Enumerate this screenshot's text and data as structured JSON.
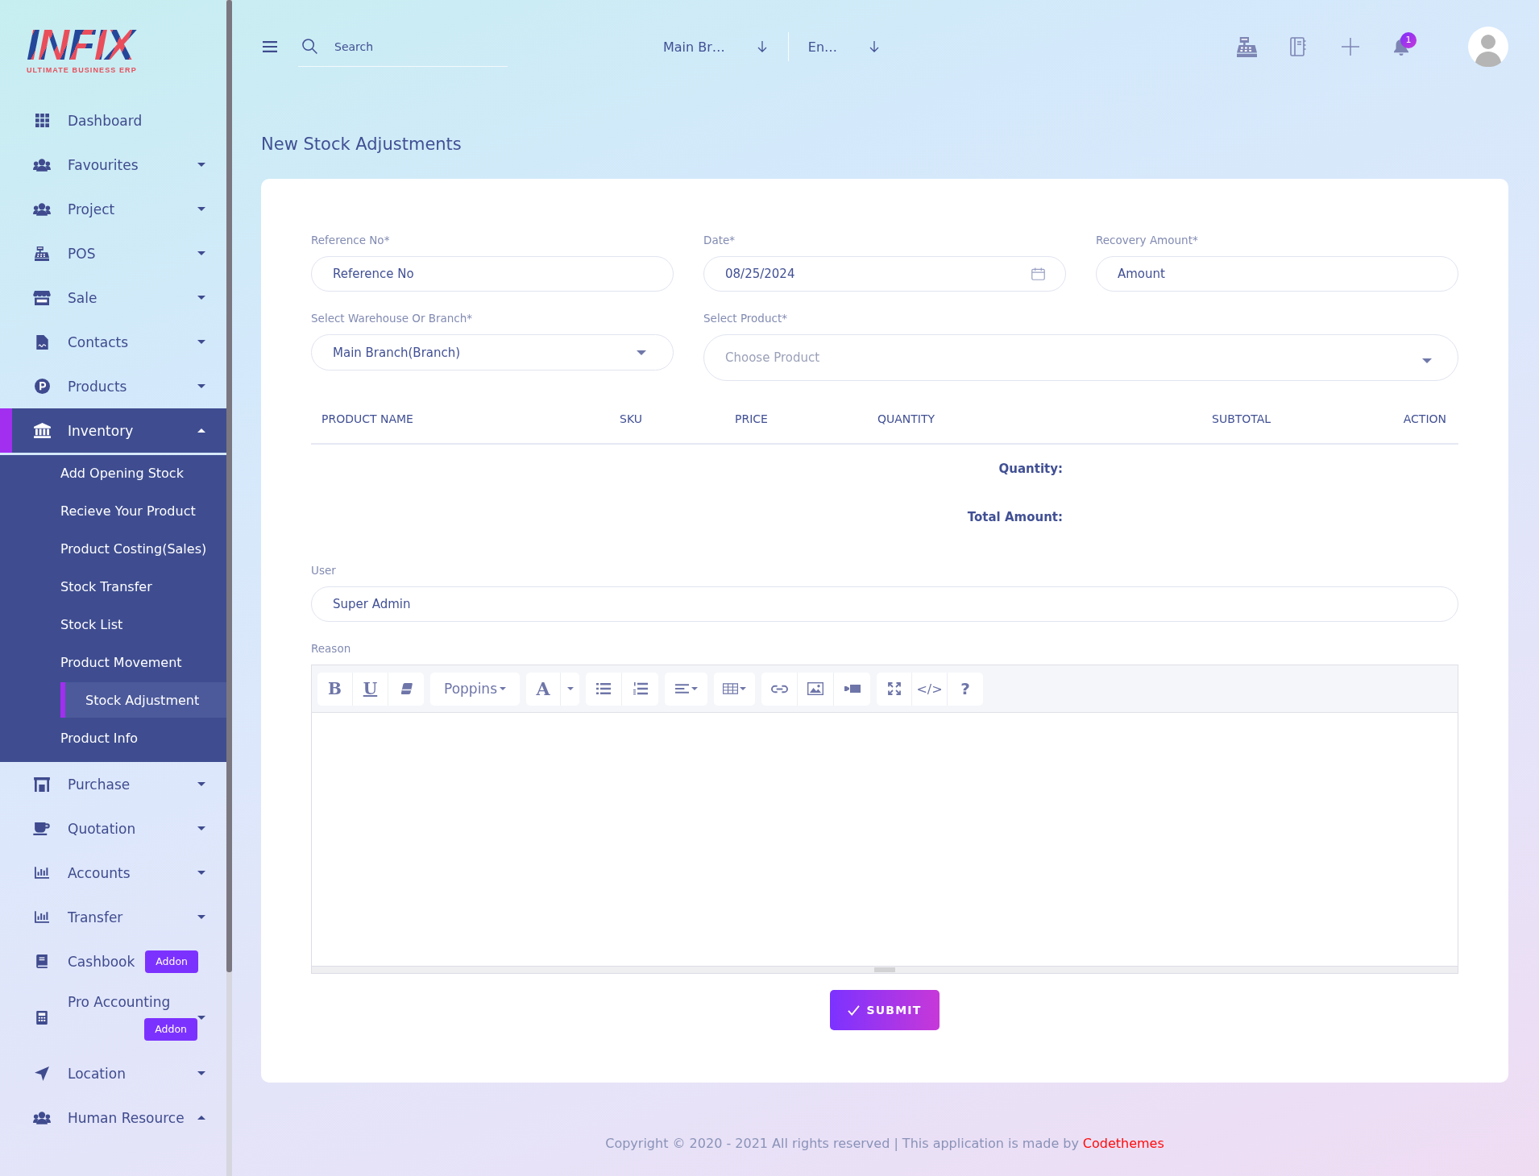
{
  "sidebar": {
    "logo": {
      "name": "INFIX",
      "tagline": "ULTIMATE BUSINESS ERP"
    },
    "items": [
      {
        "label": "Dashboard",
        "kind": "link",
        "selected": false
      },
      {
        "label": "Favourites",
        "kind": "menu",
        "expanded": false,
        "selected": false
      },
      {
        "label": "Project",
        "kind": "menu",
        "expanded": false,
        "selected": false
      },
      {
        "label": "POS",
        "kind": "menu",
        "expanded": false,
        "selected": false
      },
      {
        "label": "Sale",
        "kind": "menu",
        "expanded": false,
        "selected": false
      },
      {
        "label": "Contacts",
        "kind": "menu",
        "expanded": false,
        "selected": false
      },
      {
        "label": "Products",
        "kind": "menu",
        "expanded": false,
        "selected": false
      },
      {
        "label": "Inventory",
        "kind": "menu",
        "expanded": true,
        "selected": true,
        "children": [
          {
            "label": "Add Opening Stock",
            "selected": false
          },
          {
            "label": "Recieve Your Product",
            "selected": false
          },
          {
            "label": "Product Costing(Sales)",
            "selected": false
          },
          {
            "label": "Stock Transfer",
            "selected": false
          },
          {
            "label": "Stock List",
            "selected": false
          },
          {
            "label": "Product Movement",
            "selected": false
          },
          {
            "label": "Stock Adjustment",
            "selected": true
          },
          {
            "label": "Product Info",
            "selected": false
          }
        ]
      },
      {
        "label": "Purchase",
        "kind": "menu",
        "expanded": false,
        "selected": false
      },
      {
        "label": "Quotation",
        "kind": "menu",
        "expanded": false,
        "selected": false
      },
      {
        "label": "Accounts",
        "kind": "menu",
        "expanded": false,
        "selected": false
      },
      {
        "label": "Transfer",
        "kind": "menu",
        "expanded": false,
        "selected": false
      },
      {
        "label": "Cashbook",
        "kind": "link",
        "selected": false,
        "badge": "Addon"
      },
      {
        "label": "Pro Accounting",
        "kind": "menu",
        "expanded": false,
        "selected": false,
        "badge": "Addon"
      },
      {
        "label": "Location",
        "kind": "menu",
        "expanded": false,
        "selected": false
      },
      {
        "label": "Human Resource",
        "kind": "menu",
        "expanded": true,
        "selected": false
      }
    ]
  },
  "topbar": {
    "search": {
      "placeholder": "Search"
    },
    "selectors": [
      {
        "value": "Main Br…"
      },
      {
        "value": "En…"
      }
    ],
    "notification_count": "1"
  },
  "page": {
    "title": "New Stock Adjustments"
  },
  "form": {
    "fields": [
      {
        "label": "Reference No*",
        "kind": "text",
        "placeholder": "Reference No"
      },
      {
        "label": "Date*",
        "kind": "date",
        "value": "08/25/2024"
      },
      {
        "label": "Recovery Amount*",
        "kind": "text",
        "placeholder": "Amount"
      },
      {
        "label": "Select Warehouse Or Branch*",
        "kind": "select",
        "value": "Main Branch(Branch)"
      },
      {
        "label": "Select Product*",
        "kind": "search_select",
        "placeholder": "Choose Product"
      }
    ],
    "table": {
      "columns": [
        "PRODUCT NAME",
        "SKU",
        "PRICE",
        "QUANTITY",
        "SUBTOTAL",
        "ACTION"
      ]
    },
    "totals": [
      {
        "label": "Quantity:"
      },
      {
        "label": "Total Amount:"
      }
    ],
    "user": {
      "label": "User",
      "value": "Super Admin"
    },
    "reason": {
      "label": "Reason",
      "toolbar": {
        "bold_button": "B",
        "underline_button": "U",
        "font_dropdown": "Poppins",
        "text_tint_button": "A",
        "code_button": "</>",
        "help_button": "?"
      }
    },
    "submit": {
      "label": "SUBMIT"
    }
  },
  "footer": {
    "text": "Copyright © 2020 - 2021 All rights reserved | This application is made by",
    "link": "Codethemes"
  }
}
